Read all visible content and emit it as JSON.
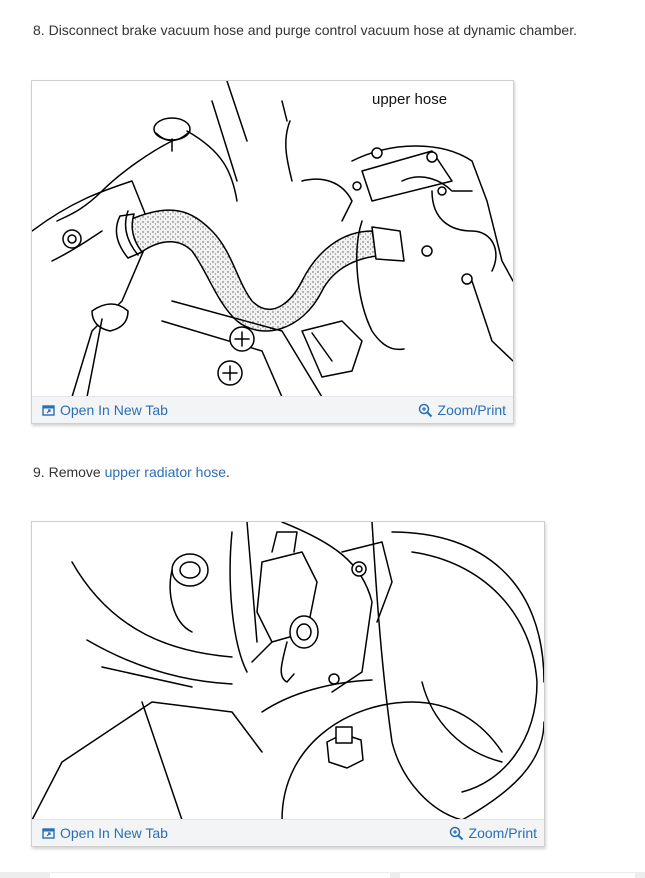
{
  "steps": [
    {
      "number": "8.",
      "text": "Disconnect brake vacuum hose and purge control vacuum hose at dynamic chamber.",
      "figure": {
        "caption": "upper hose",
        "open_tab_label": "Open In New Tab",
        "zoom_label": "Zoom/Print"
      }
    },
    {
      "number": "9.",
      "text_before": "Remove ",
      "link_text": "upper radiator hose",
      "text_after": ".",
      "figure": {
        "open_tab_label": "Open In New Tab",
        "zoom_label": "Zoom/Print"
      }
    }
  ],
  "colors": {
    "link": "#2a6fb5",
    "text": "#333333",
    "bar_bg": "#f3f4f6"
  },
  "icons": [
    "open-tab-icon",
    "zoom-icon"
  ]
}
